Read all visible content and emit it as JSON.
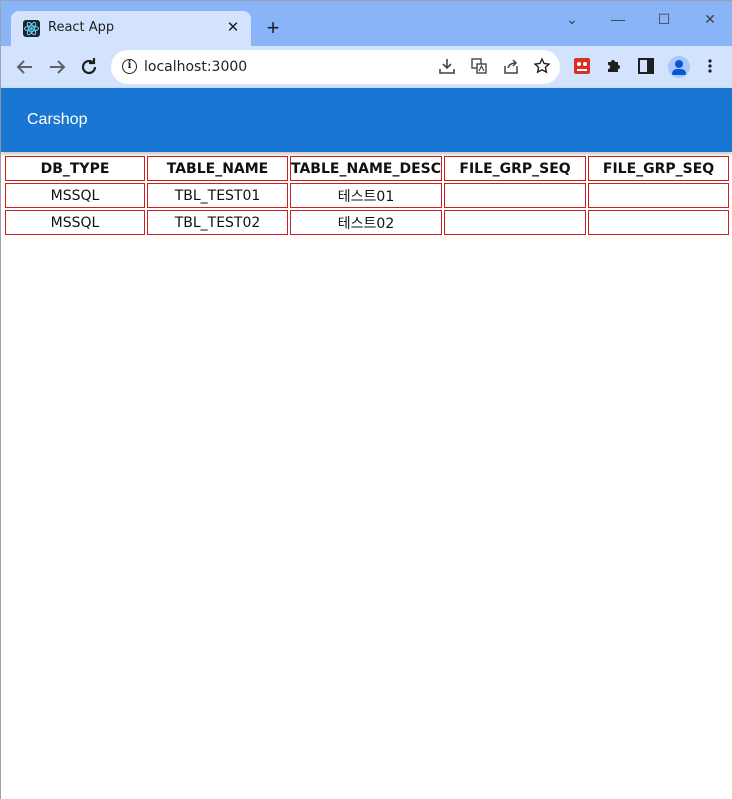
{
  "browser": {
    "tab_title": "React App",
    "tab_close": "✕",
    "new_tab": "+",
    "url": "localhost:3000",
    "window_controls": {
      "collapse": "⌄",
      "minimize": "—",
      "maximize": "☐",
      "close": "✕"
    },
    "icons": [
      "back-arrow-icon",
      "forward-arrow-icon",
      "reload-icon",
      "info-icon",
      "install-icon",
      "translate-icon",
      "share-icon",
      "bookmark-star-icon",
      "extension-red-icon",
      "puzzle-extensions-icon",
      "side-panel-icon",
      "profile-avatar-icon",
      "menu-kebab-icon"
    ]
  },
  "app": {
    "title": "Carshop",
    "accent": "#1976d2",
    "table_border": "#cc1f1f"
  },
  "table": {
    "headers": [
      "DB_TYPE",
      "TABLE_NAME",
      "TABLE_NAME_DESC",
      "FILE_GRP_SEQ",
      "FILE_GRP_SEQ"
    ],
    "rows": [
      [
        "MSSQL",
        "TBL_TEST01",
        "테스트01",
        "",
        ""
      ],
      [
        "MSSQL",
        "TBL_TEST02",
        "테스트02",
        "",
        ""
      ]
    ]
  }
}
